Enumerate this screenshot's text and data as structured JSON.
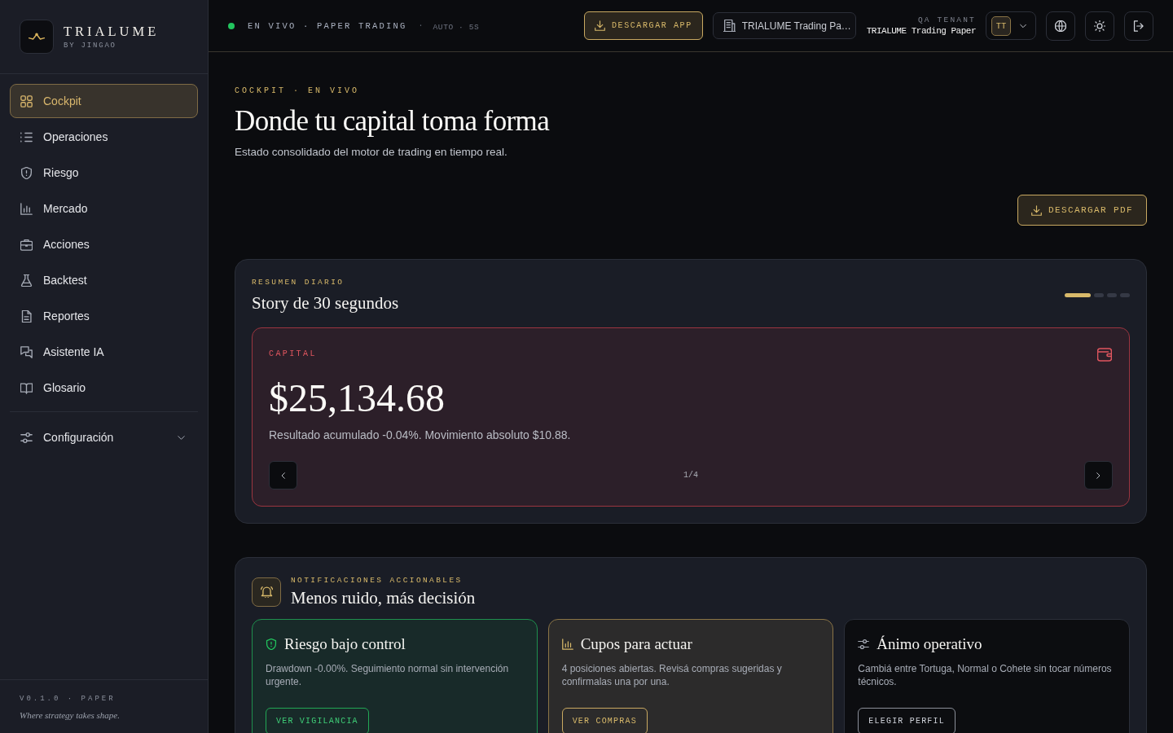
{
  "sidebar": {
    "brand": {
      "name": "TRIALUME",
      "tagline": "BY JINGAO"
    },
    "nav": [
      {
        "label": "Cockpit",
        "selected": true
      },
      {
        "label": "Operaciones",
        "selected": false
      },
      {
        "label": "Riesgo",
        "selected": false
      },
      {
        "label": "Mercado",
        "selected": false
      },
      {
        "label": "Acciones",
        "selected": false
      },
      {
        "label": "Backtest",
        "selected": false
      },
      {
        "label": "Reportes",
        "selected": false
      },
      {
        "label": "Asistente IA",
        "selected": false
      },
      {
        "label": "Glosario",
        "selected": false
      }
    ],
    "settings": {
      "label": "Configuración",
      "expanded": false
    },
    "footer": {
      "version": "V0.1.0 · PAPER",
      "motto": "Where strategy takes shape."
    }
  },
  "topbar": {
    "status": {
      "live": true,
      "label": "EN VIVO · PAPER TRADING",
      "separator": "·",
      "refresh": "AUTO · 5S"
    },
    "download_app": "DESCARGAR APP",
    "tenant_select": "TRIALUME Trading Pa…",
    "tenant": {
      "caption": "QA TENANT",
      "name": "TRIALUME Trading Paper"
    },
    "user": {
      "initials": "TT"
    }
  },
  "page": {
    "eyebrow": "COCKPIT · EN VIVO",
    "title": "Donde tu capital toma forma",
    "subtitle": "Estado consolidado del motor de trading en tiempo real.",
    "download_pdf": "DESCARGAR PDF"
  },
  "story": {
    "eyebrow": "RESUMEN DIARIO",
    "title": "Story de 30 segundos",
    "steps": [
      {
        "selected": true
      },
      {
        "selected": false
      },
      {
        "selected": false
      },
      {
        "selected": false
      }
    ],
    "slide": {
      "negative": true,
      "label": "CAPITAL",
      "value": "$25,134.68",
      "description": "Resultado acumulado -0.04%. Movimiento absoluto $10.88.",
      "counter": "1/4"
    }
  },
  "notifications": {
    "eyebrow": "NOTIFICACIONES ACCIONABLES",
    "title": "Menos ruido, más decisión",
    "cards": [
      {
        "kind": "positive",
        "title": "Riesgo bajo control",
        "text": "Drawdown -0.00%. Seguimiento normal sin intervención urgente.",
        "action": "VER VIGILANCIA"
      },
      {
        "kind": "highlight",
        "title": "Cupos para actuar",
        "text": "4 posiciones abiertas. Revisá compras sugeridas y confirmalas una por una.",
        "action": "VER COMPRAS"
      },
      {
        "kind": "neutral",
        "title": "Ánimo operativo",
        "text": "Cambiá entre Tortuga, Normal o Cohete sin tocar números técnicos.",
        "action": "ELEGIR PERFIL"
      }
    ]
  }
}
